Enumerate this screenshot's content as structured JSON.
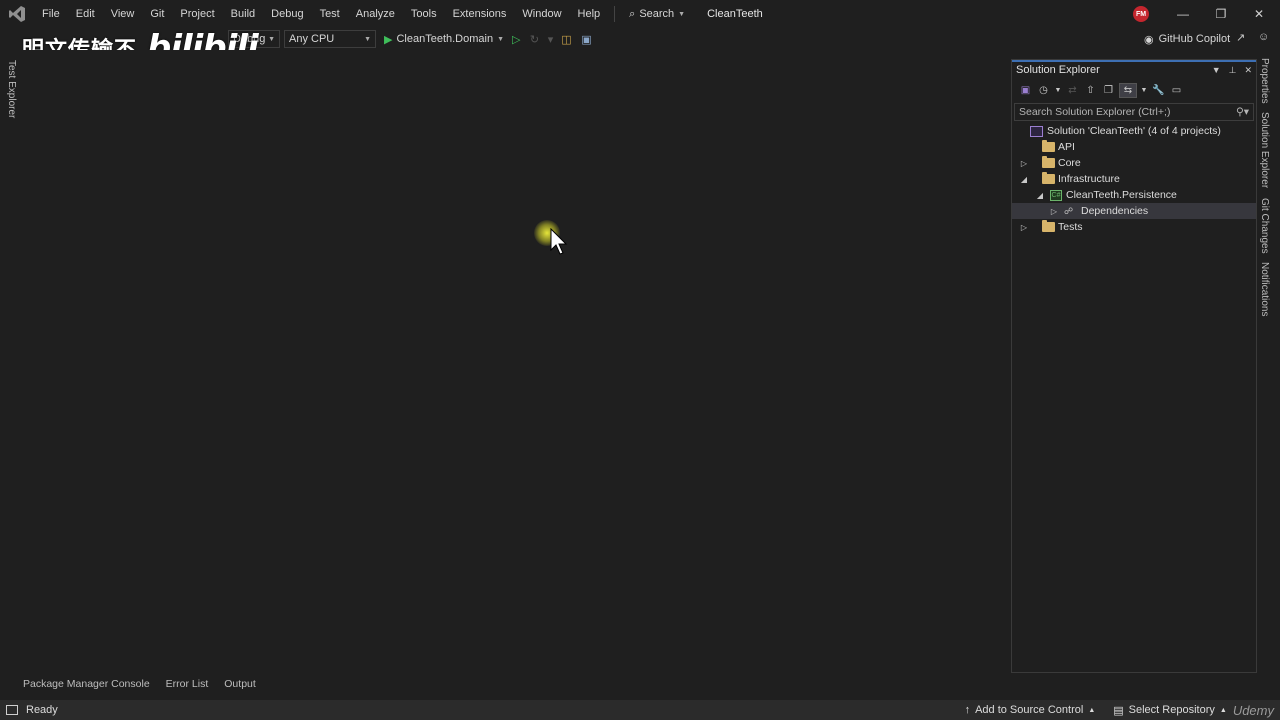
{
  "menubar": {
    "items": [
      "File",
      "Edit",
      "View",
      "Git",
      "Project",
      "Build",
      "Debug",
      "Test",
      "Analyze",
      "Tools",
      "Extensions",
      "Window",
      "Help"
    ],
    "search_label": "Search",
    "solution_name": "CleanTeeth",
    "avatar_initials": "FM"
  },
  "toolbar": {
    "configuration": "Debug",
    "platform": "Any CPU",
    "startup_project": "CleanTeeth.Domain",
    "copilot_label": "GitHub Copilot"
  },
  "watermark": {
    "text": "明文传输不",
    "logo": "bilibili"
  },
  "left_tabs": [
    "Test Explorer"
  ],
  "right_tabs": [
    "Properties",
    "Solution Explorer",
    "Git Changes",
    "Notifications"
  ],
  "solution_explorer": {
    "title": "Solution Explorer",
    "search_placeholder": "Search Solution Explorer (Ctrl+;)",
    "tree": {
      "solution": "Solution 'CleanTeeth' (4 of 4 projects)",
      "api": "API",
      "core": "Core",
      "infrastructure": "Infrastructure",
      "persistence": "CleanTeeth.Persistence",
      "dependencies": "Dependencies",
      "tests": "Tests"
    }
  },
  "bottom_tabs": [
    "Package Manager Console",
    "Error List",
    "Output"
  ],
  "statusbar": {
    "status": "Ready",
    "source_control": "Add to Source Control",
    "repository": "Select Repository",
    "brand": "Udemy"
  },
  "colors": {
    "background": "#1f1f1f",
    "accent_blue": "#3d6fb3",
    "play_green": "#3fbe5a",
    "folder_yellow": "#d7b46a",
    "statusbar": "#2b2b2b"
  }
}
